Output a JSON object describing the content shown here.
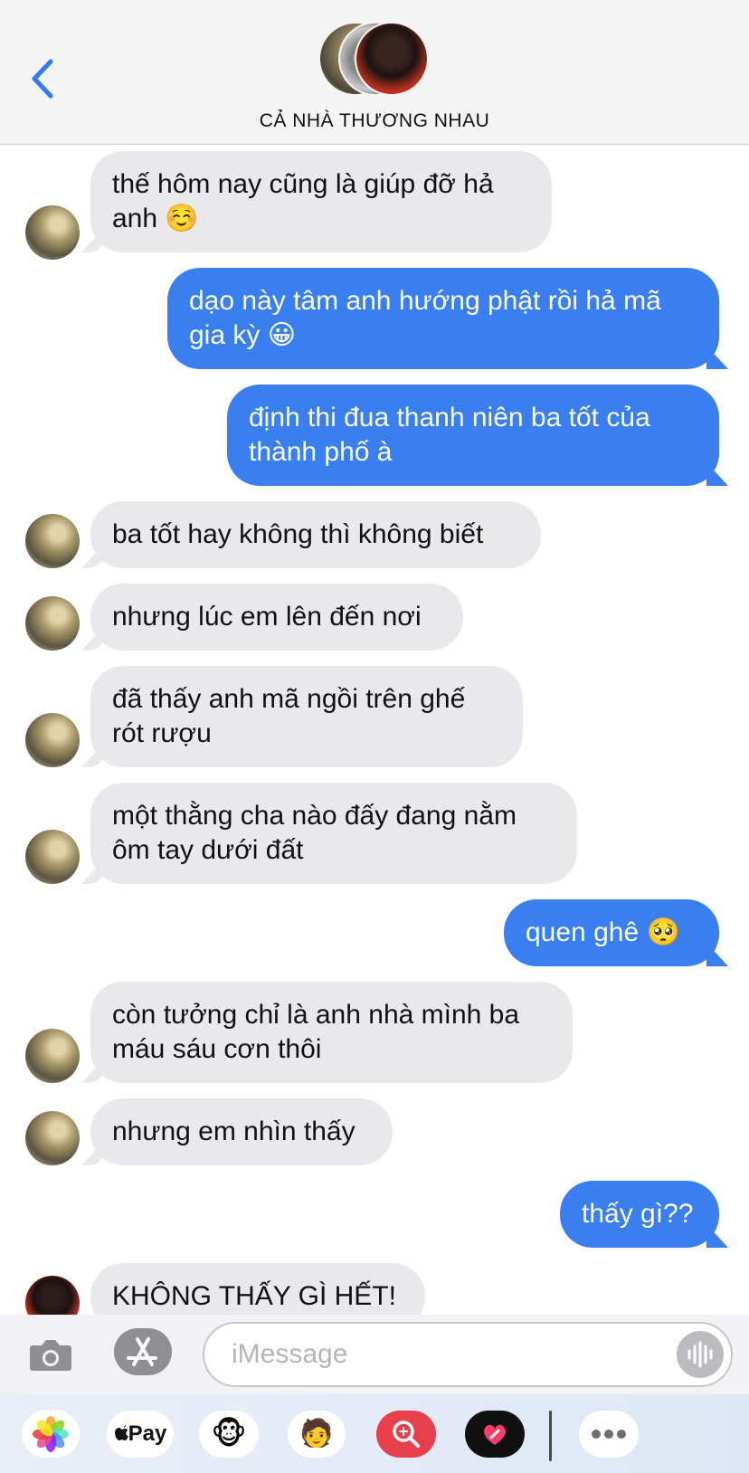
{
  "header": {
    "group_name": "CẢ NHÀ THƯƠNG NHAU"
  },
  "messages": [
    {
      "from": "other",
      "text": "thế hôm nay cũng là giúp đỡ hả\nanh ☺️"
    },
    {
      "from": "me",
      "text": "dạo này tâm anh hướng phật rồi hả mã\ngia kỳ 😀"
    },
    {
      "from": "me",
      "text": "định thi đua thanh niên ba tốt của\nthành phố à"
    },
    {
      "from": "other",
      "text": "ba tốt hay không thì không biết"
    },
    {
      "from": "other",
      "text": "nhưng lúc em lên đến nơi"
    },
    {
      "from": "other",
      "text": "đã thấy anh mã ngồi trên ghế\nrót rượu"
    },
    {
      "from": "other",
      "text": "một thằng cha nào đấy đang nằm\nôm tay dưới đất"
    },
    {
      "from": "me",
      "text": "quen ghê 🥺"
    },
    {
      "from": "other",
      "text": "còn tưởng chỉ là anh nhà mình ba\nmáu sáu cơn thôi"
    },
    {
      "from": "other",
      "text": "nhưng em nhìn thấy"
    },
    {
      "from": "me",
      "text": "thấy gì??"
    },
    {
      "from": "other2",
      "text": "KHÔNG THẤY GÌ HẾT!"
    }
  ],
  "input": {
    "placeholder": "iMessage",
    "value": ""
  },
  "tray": {
    "apple_pay_label": "Pay",
    "apps": [
      "photos-icon",
      "apple-pay-icon",
      "animoji-icon",
      "memoji-icon",
      "search-images-icon",
      "digital-touch-icon",
      "more-icon"
    ]
  },
  "colors": {
    "sent_bubble": "#3a7ff0",
    "received_bubble": "#e9e9eb",
    "accent": "#3478f6"
  }
}
